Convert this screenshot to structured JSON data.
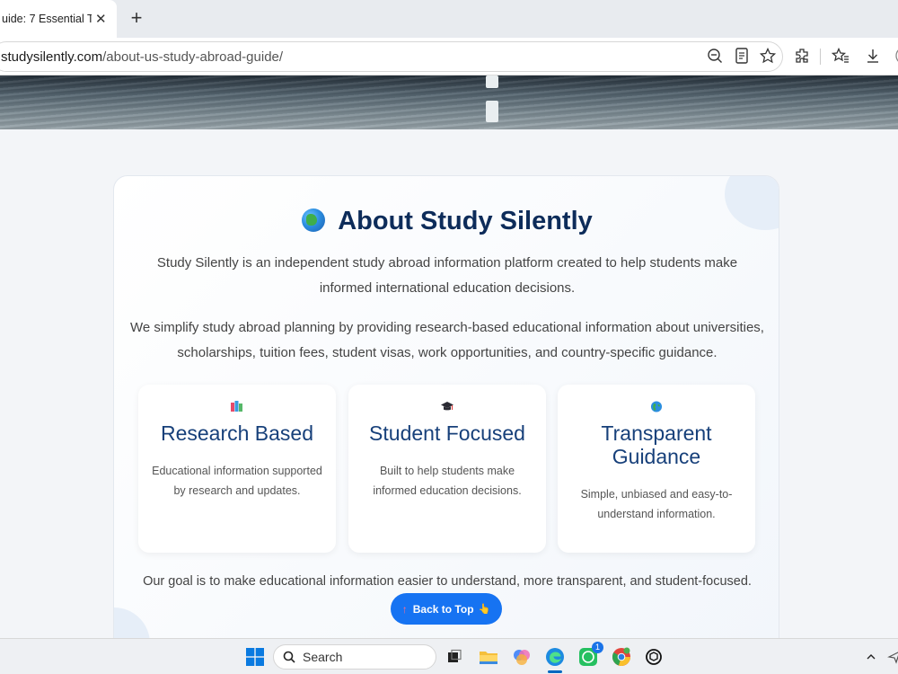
{
  "browser": {
    "tab_title": "uide: 7 Essential Ti",
    "close_glyph": "✕",
    "new_tab_glyph": "+",
    "url_domain": "studysilently.com",
    "url_path": "/about-us-study-abroad-guide/"
  },
  "about": {
    "title": "About Study Silently",
    "intro": "Study Silently is an independent study abroad information platform created to help students make informed international education decisions.",
    "mission": "We simplify study abroad planning by providing research-based educational information about universities, scholarships, tuition fees, student visas, work opportunities, and country-specific guidance.",
    "features": [
      {
        "icon": "books-icon",
        "title": "Research Based",
        "desc": "Educational information supported by research and updates."
      },
      {
        "icon": "graduation-cap-icon",
        "title": "Student Focused",
        "desc": "Built to help students make informed education decisions."
      },
      {
        "icon": "globe-icon",
        "title": "Transparent Guidance",
        "desc": "Simple, unbiased and easy-to-understand information."
      }
    ],
    "goal": "Our goal is to make educational information easier to understand, more transparent, and student-focused."
  },
  "back_to_top": {
    "label": "Back to Top",
    "prefix": "↑",
    "suffix": "👆"
  },
  "taskbar": {
    "search_label": "Search",
    "whatsapp_badge": "1"
  },
  "colors": {
    "accent": "#1673f2",
    "heading": "#0d2c5a",
    "feature_title": "#17407a"
  }
}
